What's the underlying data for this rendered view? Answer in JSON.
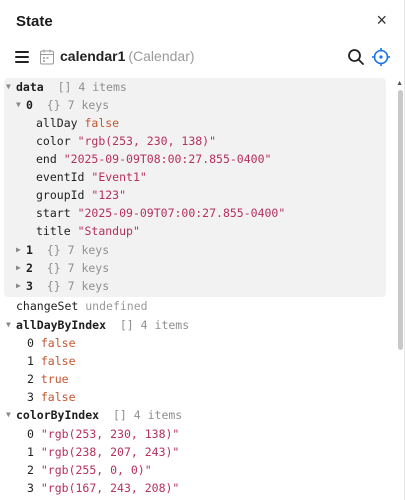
{
  "panel": {
    "title": "State",
    "close_glyph": "×"
  },
  "toolbar": {
    "component_name": "calendar1",
    "component_type": "(Calendar)"
  },
  "tree": {
    "data": {
      "key": "data",
      "type_marker": "[]",
      "count": "4 items",
      "item0": {
        "key": "0",
        "type_marker": "{}",
        "count": "7 keys",
        "fields": [
          {
            "key": "allDay",
            "value": "false"
          },
          {
            "key": "color",
            "value": "\"rgb(253, 230, 138)\""
          },
          {
            "key": "end",
            "value": "\"2025-09-09T08:00:27.855-0400\""
          },
          {
            "key": "eventId",
            "value": "\"Event1\""
          },
          {
            "key": "groupId",
            "value": "\"123\""
          },
          {
            "key": "start",
            "value": "\"2025-09-09T07:00:27.855-0400\""
          },
          {
            "key": "title",
            "value": "\"Standup\""
          }
        ]
      },
      "collapsed": [
        {
          "key": "1",
          "type_marker": "{}",
          "count": "7 keys"
        },
        {
          "key": "2",
          "type_marker": "{}",
          "count": "7 keys"
        },
        {
          "key": "3",
          "type_marker": "{}",
          "count": "7 keys"
        }
      ]
    },
    "changeSet": {
      "key": "changeSet",
      "value": "undefined"
    },
    "allDayByIndex": {
      "key": "allDayByIndex",
      "type_marker": "[]",
      "count": "4 items",
      "items": [
        {
          "key": "0",
          "value": "false"
        },
        {
          "key": "1",
          "value": "false"
        },
        {
          "key": "2",
          "value": "true"
        },
        {
          "key": "3",
          "value": "false"
        }
      ]
    },
    "colorByIndex": {
      "key": "colorByIndex",
      "type_marker": "[]",
      "count": "4 items",
      "items": [
        {
          "key": "0",
          "value": "\"rgb(253, 230, 138)\""
        },
        {
          "key": "1",
          "value": "\"rgb(238, 207, 243)\""
        },
        {
          "key": "2",
          "value": "\"rgb(255, 0, 0)\""
        },
        {
          "key": "3",
          "value": "\"rgb(167, 243, 208)\""
        }
      ]
    }
  },
  "colors": {
    "string": "#b5305d",
    "boolean": "#c4552e",
    "accent": "#1a73e8"
  },
  "icons": [
    "close-icon",
    "menu-icon",
    "calendar-icon",
    "search-icon",
    "target-icon",
    "chevron-down-icon",
    "chevron-right-icon"
  ]
}
